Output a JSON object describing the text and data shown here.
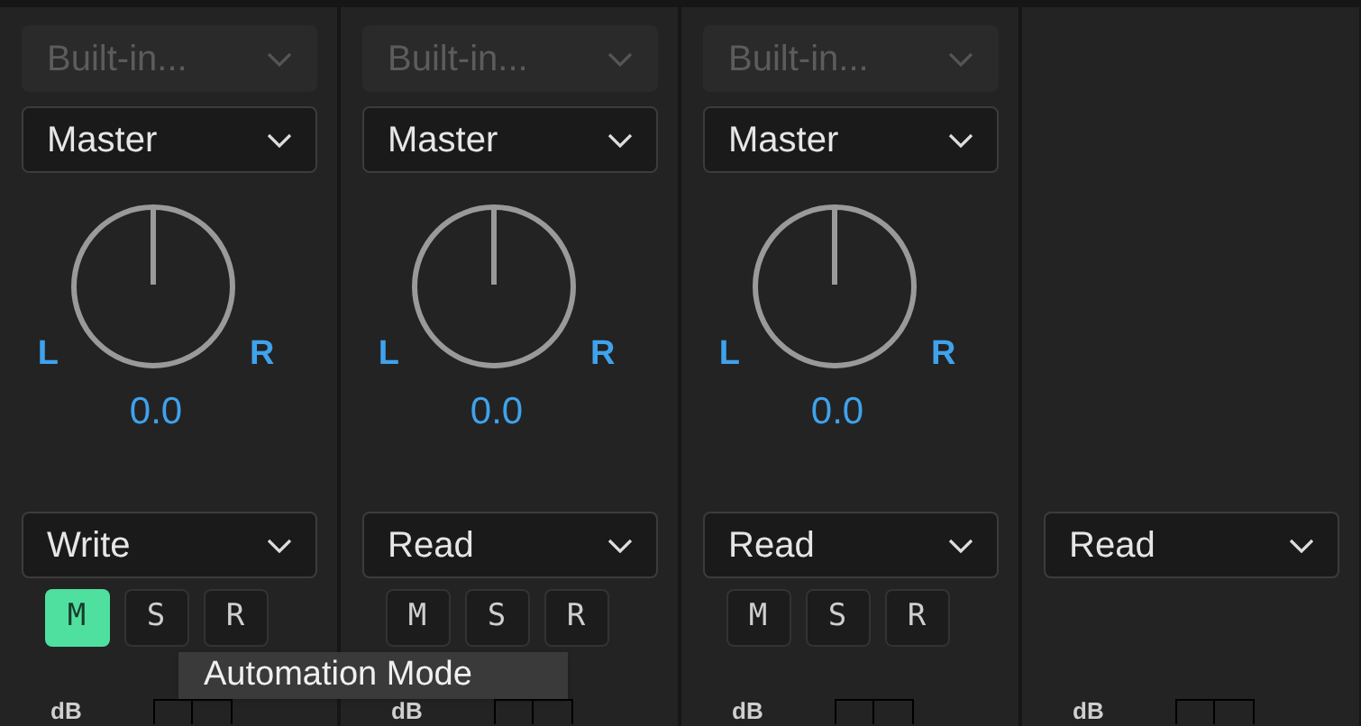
{
  "channels": [
    {
      "input": {
        "value": "Built-in...",
        "disabled": true
      },
      "output": "Master",
      "pan": {
        "left": "L",
        "right": "R",
        "reading": "0.0"
      },
      "automation": "Write",
      "buttons": [
        {
          "label": "M",
          "on": true
        },
        {
          "label": "S",
          "on": false
        },
        {
          "label": "R",
          "on": false
        }
      ],
      "meter_label": "dB"
    },
    {
      "input": {
        "value": "Built-in...",
        "disabled": true
      },
      "output": "Master",
      "pan": {
        "left": "L",
        "right": "R",
        "reading": "0.0"
      },
      "automation": "Read",
      "buttons": [
        {
          "label": "M",
          "on": false
        },
        {
          "label": "S",
          "on": false
        },
        {
          "label": "R",
          "on": false
        }
      ],
      "meter_label": "dB"
    },
    {
      "input": {
        "value": "Built-in...",
        "disabled": true
      },
      "output": "Master",
      "pan": {
        "left": "L",
        "right": "R",
        "reading": "0.0"
      },
      "automation": "Read",
      "buttons": [
        {
          "label": "M",
          "on": false
        },
        {
          "label": "S",
          "on": false
        },
        {
          "label": "R",
          "on": false
        }
      ],
      "meter_label": "dB"
    },
    {
      "automation": "Read",
      "meter_label": "dB"
    }
  ],
  "tooltip": "Automation Mode"
}
